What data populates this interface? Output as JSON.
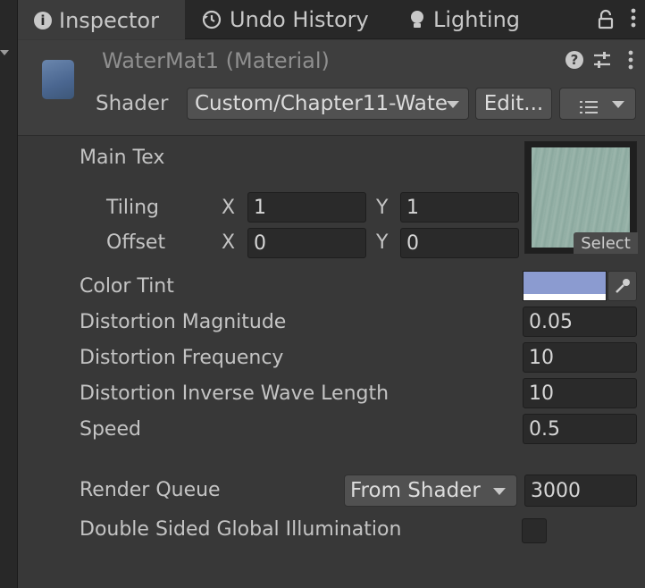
{
  "tabs": [
    {
      "label": "Inspector",
      "icon": "info-icon",
      "active": true
    },
    {
      "label": "Undo History",
      "icon": "history-icon",
      "active": false
    },
    {
      "label": "Lighting",
      "icon": "lightbulb-icon",
      "active": false
    }
  ],
  "header": {
    "title": "WaterMat1 (Material)",
    "shader_label": "Shader",
    "shader_value": "Custom/Chapter11-Wate",
    "edit_label": "Edit..."
  },
  "main_tex": {
    "label": "Main Tex",
    "tiling_label": "Tiling",
    "offset_label": "Offset",
    "axis_x": "X",
    "axis_y": "Y",
    "tiling_x": "1",
    "tiling_y": "1",
    "offset_x": "0",
    "offset_y": "0",
    "select_label": "Select"
  },
  "properties": {
    "color_tint_label": "Color Tint",
    "color_tint_value": "#8b9bd0",
    "distortion_magnitude_label": "Distortion Magnitude",
    "distortion_magnitude": "0.05",
    "distortion_frequency_label": "Distortion Frequency",
    "distortion_frequency": "10",
    "inverse_wave_length_label": "Distortion Inverse Wave Length",
    "inverse_wave_length": "10",
    "speed_label": "Speed",
    "speed": "0.5"
  },
  "render_queue": {
    "label": "Render Queue",
    "mode": "From Shader",
    "value": "3000"
  },
  "dsgi": {
    "label": "Double Sided Global Illumination",
    "checked": false
  }
}
